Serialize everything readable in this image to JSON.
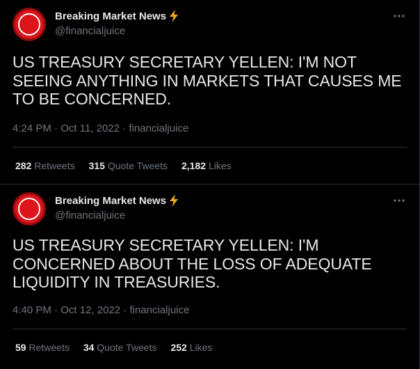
{
  "tweets": [
    {
      "display_name": "Breaking Market News",
      "verified_icon": "lightning-bolt-icon",
      "handle": "@financialjuice",
      "text": "US TREASURY SECRETARY YELLEN: I'M NOT SEEING ANYTHING IN MARKETS THAT CAUSES ME TO BE CONCERNED.",
      "time": "4:24 PM",
      "date": "Oct 11, 2022",
      "source": "financialjuice",
      "separator": " · ",
      "retweets_count": "282",
      "retweets_label": "Retweets",
      "quotes_count": "315",
      "quotes_label": "Quote Tweets",
      "likes_count": "2,182",
      "likes_label": "Likes"
    },
    {
      "display_name": "Breaking Market News",
      "verified_icon": "lightning-bolt-icon",
      "handle": "@financialjuice",
      "text": "US TREASURY SECRETARY YELLEN: I'M CONCERNED ABOUT THE LOSS OF ADEQUATE LIQUIDITY IN TREASURIES.",
      "time": "4:40 PM",
      "date": "Oct 12, 2022",
      "source": "financialjuice",
      "separator": " · ",
      "retweets_count": "59",
      "retweets_label": "Retweets",
      "quotes_count": "34",
      "quotes_label": "Quote Tweets",
      "likes_count": "252",
      "likes_label": "Likes"
    }
  ],
  "colors": {
    "background": "#000000",
    "text_primary": "#e7e9ea",
    "text_secondary": "#71767b",
    "border": "#2f3336",
    "avatar_red": "#d9141a",
    "bolt_yellow": "#f5a623"
  }
}
